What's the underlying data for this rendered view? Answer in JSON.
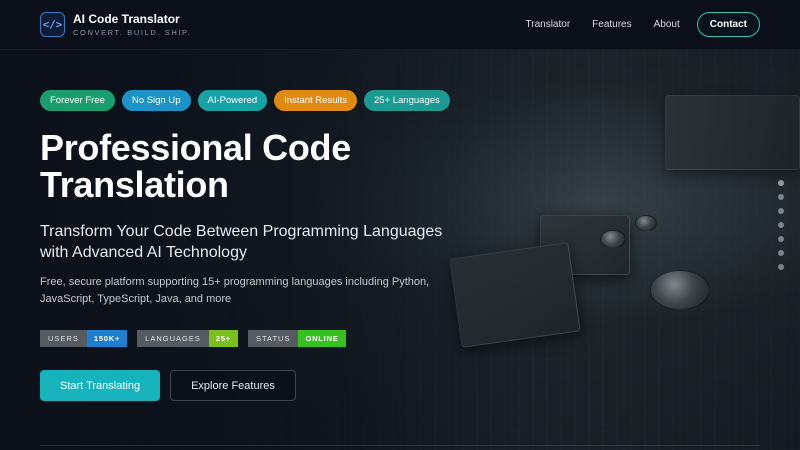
{
  "header": {
    "logo_glyph": "</>",
    "brand_name": "AI Code Translator",
    "brand_tagline": "CONVERT. BUILD. SHIP.",
    "nav": [
      {
        "label": "Translator"
      },
      {
        "label": "Features"
      },
      {
        "label": "About"
      }
    ],
    "contact_label": "Contact"
  },
  "pills": [
    {
      "label": "Forever Free",
      "color": "#1a9e6e"
    },
    {
      "label": "No Sign Up",
      "color": "#1c93c7"
    },
    {
      "label": "AI-Powered",
      "color": "#15a3a6"
    },
    {
      "label": "Instant Results",
      "color": "#e08a12"
    },
    {
      "label": "25+ Languages",
      "color": "#1a9a91"
    }
  ],
  "hero": {
    "title": "Professional Code Translation",
    "subtitle": "Transform Your Code Between Programming Languages with Advanced AI Technology",
    "description": "Free, secure platform supporting 15+ programming languages including Python, JavaScript, TypeScript, Java, and more"
  },
  "badges": [
    {
      "key": "USERS",
      "value": "150K+",
      "color": "#1c7fd0"
    },
    {
      "key": "LANGUAGES",
      "value": "25+",
      "color": "#7bbf1b"
    },
    {
      "key": "STATUS",
      "value": "ONLINE",
      "color": "#35c11f"
    }
  ],
  "ctas": {
    "primary": "Start Translating",
    "secondary": "Explore Features"
  },
  "carousel": {
    "slide_count": 7,
    "active_index": 0
  }
}
